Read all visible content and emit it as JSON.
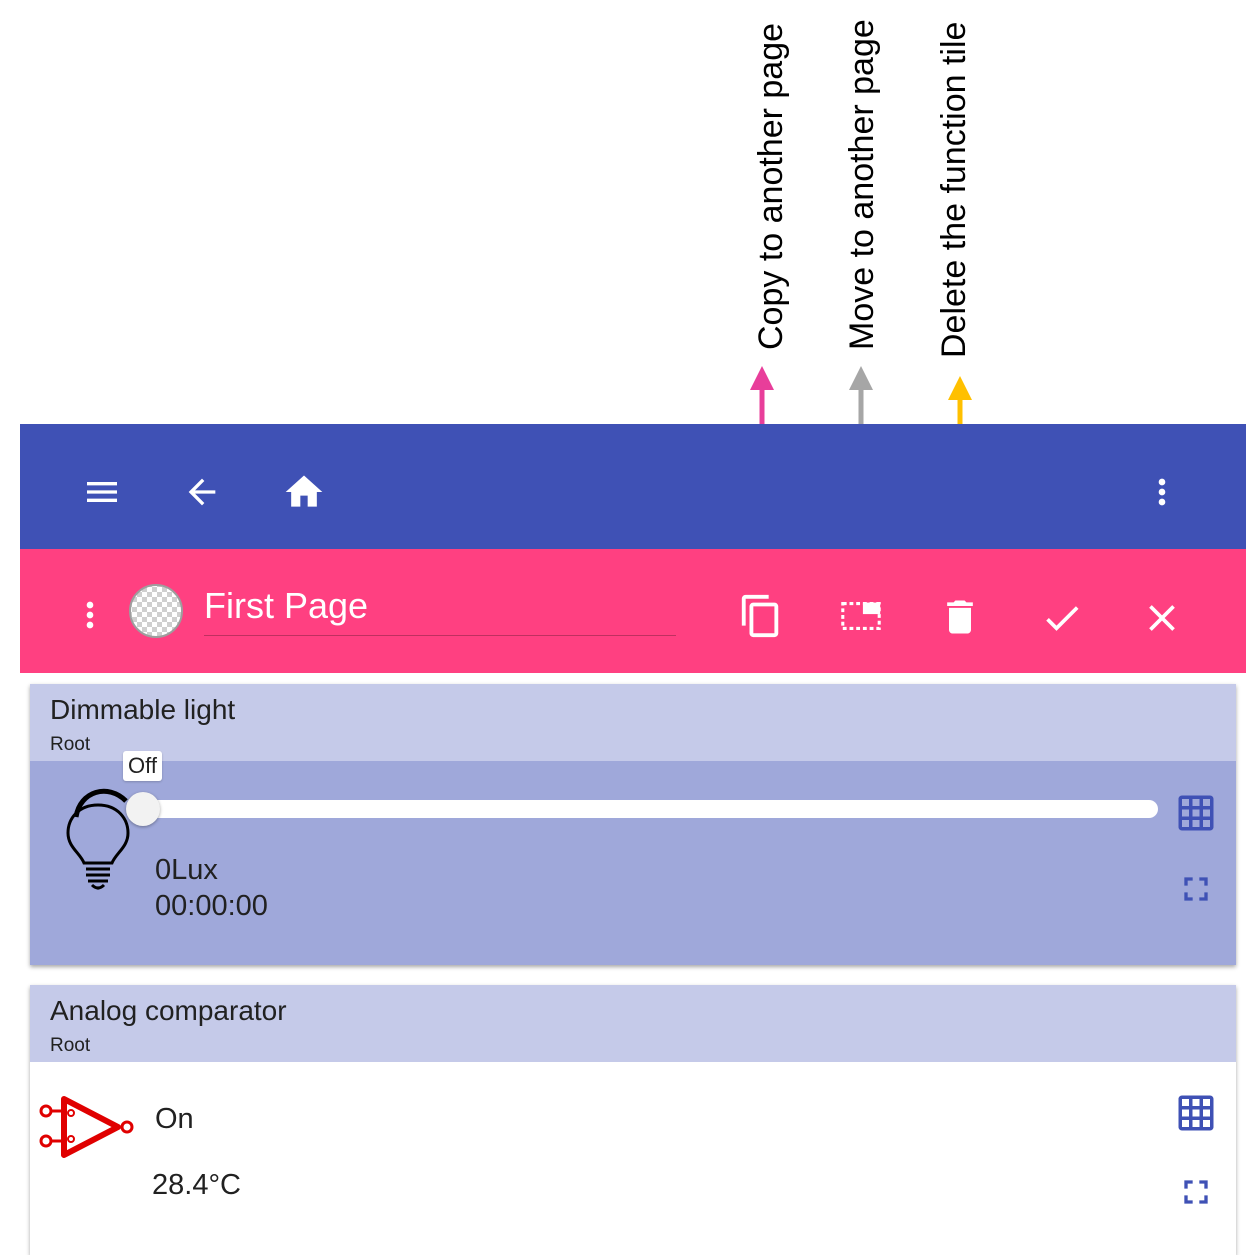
{
  "annotations": {
    "copy": {
      "label": "Copy to another page",
      "color": "#e83e9a"
    },
    "move": {
      "label": "Move to another page",
      "color": "#a6a6a6"
    },
    "delete": {
      "label": "Delete the function tile",
      "color": "#ffc000"
    }
  },
  "appbar": {
    "color": "#3f51b5",
    "icons": [
      "menu-icon",
      "arrow-back-icon",
      "home-icon",
      "more-vert-icon"
    ]
  },
  "edit_toolbar": {
    "color": "#ff4081",
    "page_name": "First Page",
    "icons": [
      "more-vert-icon",
      "page-avatar-icon",
      "copy-icon",
      "move-icon",
      "delete-icon",
      "check-icon",
      "close-icon"
    ]
  },
  "tiles": [
    {
      "title": "Dimmable light",
      "subtitle": "Root",
      "slider_tooltip": "Off",
      "slider_level": 0,
      "lux": "0Lux",
      "time": "00:00:00",
      "icons": [
        "bulb-icon",
        "grid-icon",
        "fullscreen-icon"
      ]
    },
    {
      "title": "Analog comparator",
      "subtitle": "Root",
      "state": "On",
      "temperature": "28.4°C",
      "icons": [
        "comparator-icon",
        "grid-icon",
        "fullscreen-icon"
      ]
    }
  ],
  "colors": {
    "tile_header": "#c5cae9",
    "tile_body_active": "#9fa8da",
    "icon_blue": "#3f51b5",
    "comparator_red": "#e00000"
  }
}
